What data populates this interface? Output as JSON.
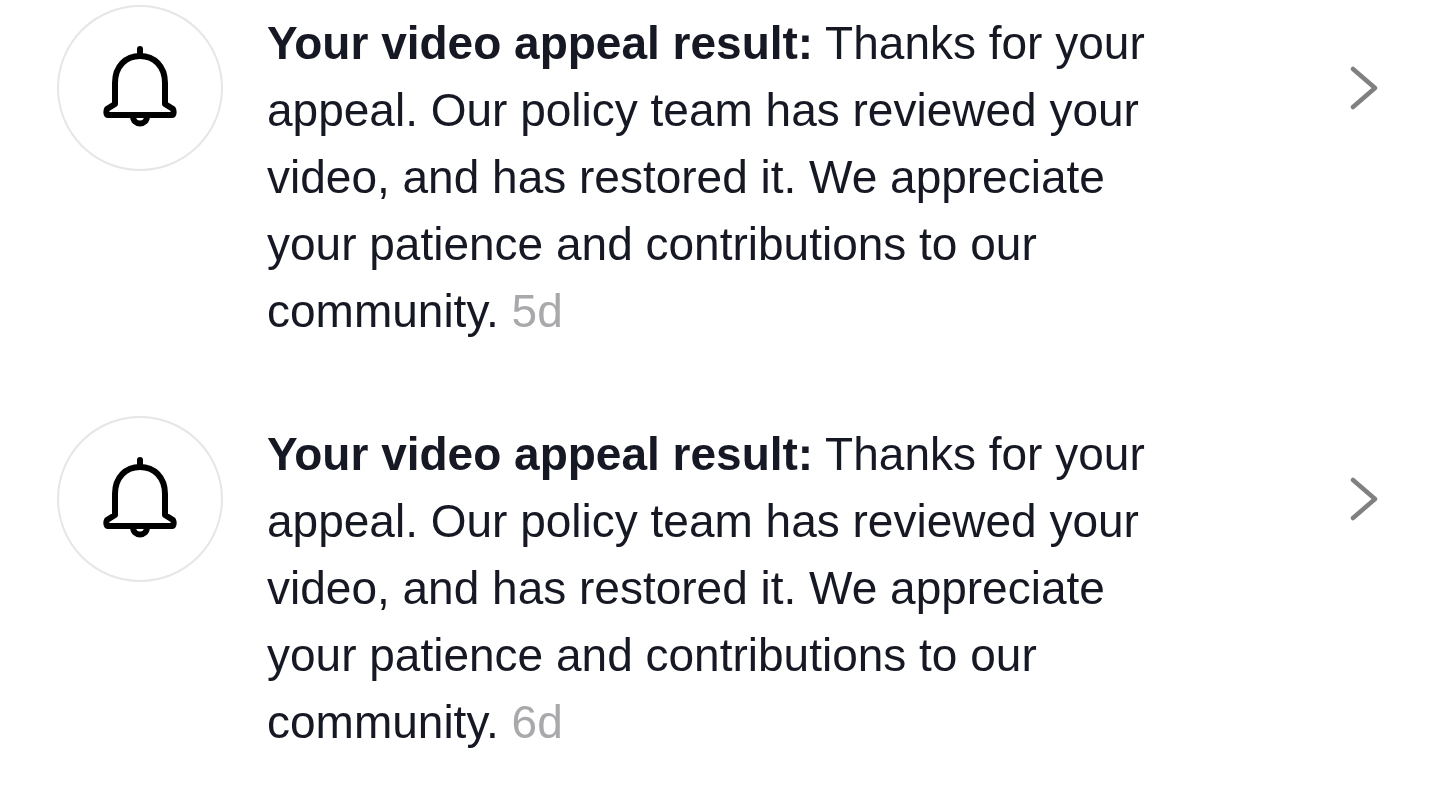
{
  "notifications": [
    {
      "text": "**Your video appeal result:** Thanks for your appeal. Our policy team has reviewed your video, and has restored it. We appreciate your patience and contributions to our community.",
      "time": "5d"
    },
    {
      "text": "**Your video appeal result:** Thanks for your appeal. Our policy team has reviewed your video, and has restored it. We appreciate your patience and contributions to our community.",
      "time": "6d"
    }
  ]
}
